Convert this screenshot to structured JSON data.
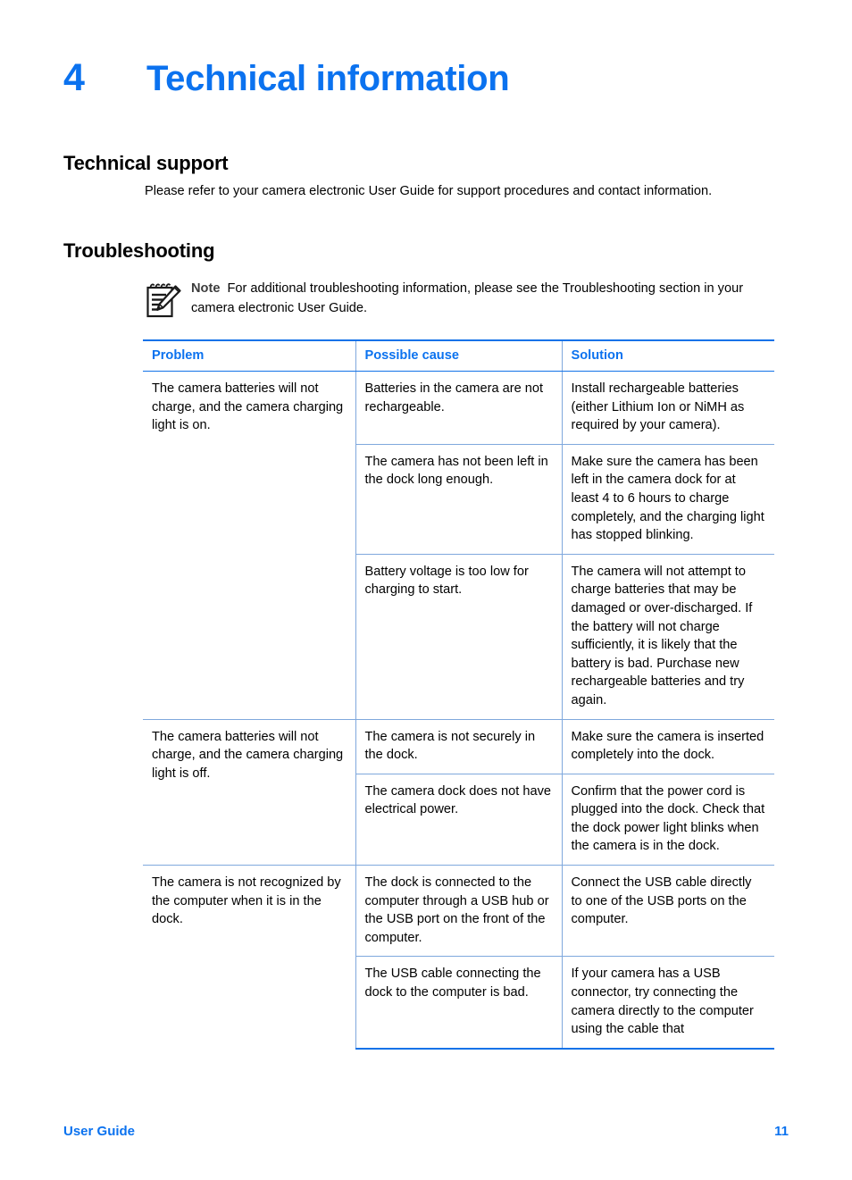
{
  "chapter": {
    "number": "4",
    "title": "Technical information",
    "accent_color": "#0b72ef"
  },
  "sections": {
    "technical_support": {
      "heading": "Technical support",
      "body": "Please refer to your camera electronic User Guide for support procedures and contact information."
    },
    "troubleshooting": {
      "heading": "Troubleshooting",
      "note": {
        "icon": "notepad-pencil-icon",
        "label": "Note",
        "text": "For additional troubleshooting information, please see the Troubleshooting section in your camera electronic User Guide."
      }
    }
  },
  "table": {
    "headers": [
      "Problem",
      "Possible cause",
      "Solution"
    ],
    "header_color": "#0b72ef",
    "border_color": "#1272e8",
    "inner_border_color": "#7fa8dd",
    "groups": [
      {
        "problem": "The camera batteries will not charge, and the camera charging light is on.",
        "rows": [
          {
            "cause": "Batteries in the camera are not rechargeable.",
            "solution": "Install rechargeable batteries (either Lithium Ion or NiMH as required by your camera)."
          },
          {
            "cause": "The camera has not been left in the dock long enough.",
            "solution": "Make sure the camera has been left in the camera dock for at least 4 to 6 hours to charge completely, and the charging light has stopped blinking."
          },
          {
            "cause": "Battery voltage is too low for charging to start.",
            "solution": "The camera will not attempt to charge batteries that may be damaged or over-discharged. If the battery will not charge sufficiently, it is likely that the battery is bad. Purchase new rechargeable batteries and try again."
          }
        ]
      },
      {
        "problem": "The camera batteries will not charge, and the camera charging light is off.",
        "rows": [
          {
            "cause": "The camera is not securely in the dock.",
            "solution": "Make sure the camera is inserted completely into the dock."
          },
          {
            "cause": "The camera dock does not have electrical power.",
            "solution": "Confirm that the power cord is plugged into the dock. Check that the dock power light blinks when the camera is in the dock."
          }
        ]
      },
      {
        "problem": "The camera is not recognized by the computer when it is in the dock.",
        "rows": [
          {
            "cause": "The dock is connected to the computer through a USB hub or the USB port on the front of the computer.",
            "solution": "Connect the USB cable directly to one of the USB ports on the computer."
          },
          {
            "cause": "The USB cable connecting the dock to the computer is bad.",
            "solution": "If your camera has a USB connector, try connecting the camera directly to the computer using the cable that"
          }
        ]
      }
    ]
  },
  "footer": {
    "label": "User Guide",
    "page_number": "11"
  }
}
